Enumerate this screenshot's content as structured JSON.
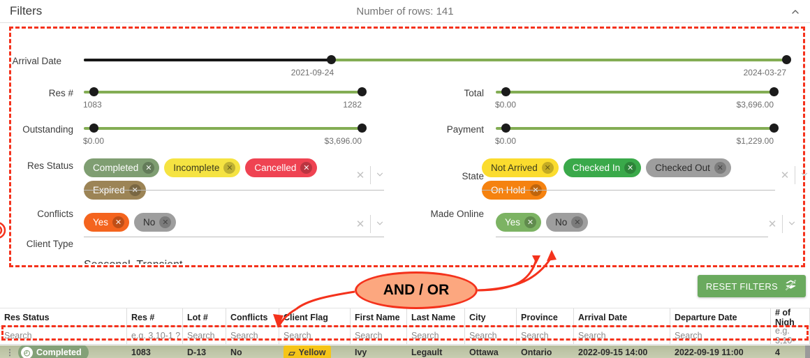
{
  "header": {
    "title": "Filters",
    "rows_label": "Number of rows: 141",
    "collapse_icon": "chevron-up-icon"
  },
  "filters": {
    "arrival_date": {
      "label": "Arrival Date",
      "low_value": "2021-09-24",
      "high_value": "2024-03-27"
    },
    "res_number": {
      "label": "Res #",
      "low_value": "1083",
      "high_value": "1282"
    },
    "total": {
      "label": "Total",
      "low_value": "$0.00",
      "high_value": "$3,696.00"
    },
    "outstanding": {
      "label": "Outstanding",
      "low_value": "$0.00",
      "high_value": "$3,696.00"
    },
    "payment": {
      "label": "Payment",
      "low_value": "$0.00",
      "high_value": "$1,229.00"
    },
    "res_status": {
      "label": "Res Status",
      "chips": [
        {
          "label": "Completed",
          "bg": "#7f9e72",
          "fg": "#ffffff"
        },
        {
          "label": "Incomplete",
          "bg": "#f5e342",
          "fg": "#3a3a1c"
        },
        {
          "label": "Cancelled",
          "bg": "#ef4352",
          "fg": "#ffffff"
        },
        {
          "label": "Expired",
          "bg": "#9c8456",
          "fg": "#ffffff"
        }
      ]
    },
    "state": {
      "label": "State",
      "chips": [
        {
          "label": "Not Arrived",
          "bg": "#fbdc2e",
          "fg": "#3a3a1c"
        },
        {
          "label": "Checked In",
          "bg": "#3aa94a",
          "fg": "#ffffff"
        },
        {
          "label": "Checked Out",
          "bg": "#9e9e9e",
          "fg": "#2b2b2b"
        },
        {
          "label": "On Hold",
          "bg": "#f58210",
          "fg": "#ffffff"
        }
      ]
    },
    "conflicts": {
      "label": "Conflicts",
      "chips": [
        {
          "label": "Yes",
          "bg": "#f4641e",
          "fg": "#ffffff"
        },
        {
          "label": "No",
          "bg": "#9e9e9e",
          "fg": "#2b2b2b"
        }
      ]
    },
    "made_online": {
      "label": "Made Online",
      "chips": [
        {
          "label": "Yes",
          "bg": "#7cb363",
          "fg": "#ffffff"
        },
        {
          "label": "No",
          "bg": "#9e9e9e",
          "fg": "#2b2b2b"
        }
      ]
    },
    "client_type": {
      "label": "Client Type",
      "value": "Seasonal, Transient",
      "caret_icon": "caret-down-icon"
    },
    "clear_icon": "clear-x-icon",
    "expand_icon": "chevron-down-icon"
  },
  "actions": {
    "reset_filters_label": "RESET FILTERS",
    "reset_filters_icon": "filter-off-icon"
  },
  "annotations": {
    "and_or_label": "AND / OR"
  },
  "table": {
    "columns": [
      {
        "header": "Res Status",
        "placeholder": "Search"
      },
      {
        "header": "Res #",
        "placeholder": "e.g. 3,10-1 ?"
      },
      {
        "header": "Lot #",
        "placeholder": "Search"
      },
      {
        "header": "Conflicts",
        "placeholder": "Search"
      },
      {
        "header": "Client Flag",
        "placeholder": "Search"
      },
      {
        "header": "First Name",
        "placeholder": "Search"
      },
      {
        "header": "Last Name",
        "placeholder": "Search"
      },
      {
        "header": "City",
        "placeholder": "Search"
      },
      {
        "header": "Province",
        "placeholder": "Search"
      },
      {
        "header": "Arrival Date",
        "placeholder": "Search"
      },
      {
        "header": "Departure Date",
        "placeholder": "Search"
      },
      {
        "header": "# of Nigh",
        "placeholder": "e.g. 3,10-"
      }
    ],
    "first_row": {
      "res_status": "Completed",
      "res_number": "1083",
      "lot_number": "D-13",
      "conflicts": "No",
      "client_flag": "Yellow",
      "first_name": "Ivy",
      "last_name": "Legault",
      "city": "Ottawa",
      "province": "Ontario",
      "arrival_date": "2022-09-15 14:00",
      "departure_date": "2022-09-19 11:00",
      "nights": "4"
    }
  }
}
